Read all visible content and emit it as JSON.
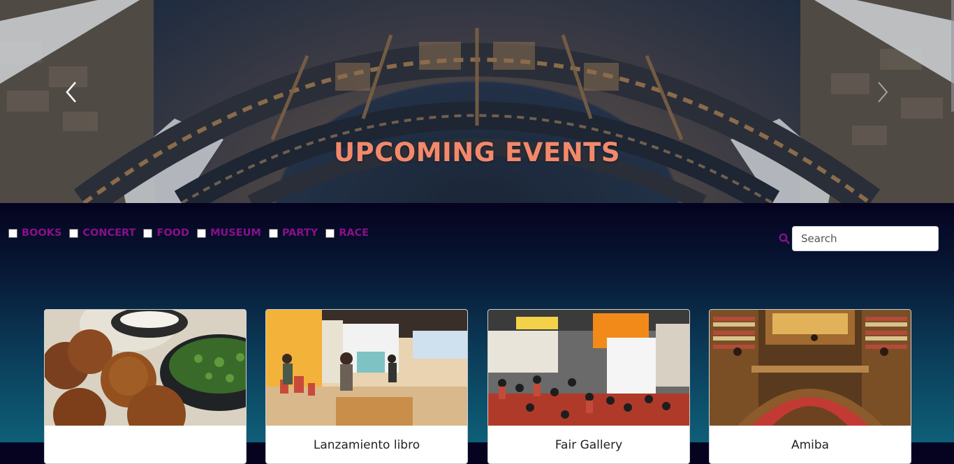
{
  "hero": {
    "title": "UPCOMING EVENTS",
    "title_color": "#f2896b"
  },
  "carousel": {
    "prev_icon": "chevron-left-icon",
    "next_icon": "chevron-right-icon"
  },
  "filters": [
    {
      "label": "BOOKS",
      "checked": false
    },
    {
      "label": "CONCERT",
      "checked": false
    },
    {
      "label": "FOOD",
      "checked": false
    },
    {
      "label": "MUSEUM",
      "checked": false
    },
    {
      "label": "PARTY",
      "checked": false
    },
    {
      "label": "RACE",
      "checked": false
    }
  ],
  "filter_color": "#8a0f8a",
  "search": {
    "placeholder": "Search",
    "value": "",
    "icon": "search-icon"
  },
  "cards": [
    {
      "title": ""
    },
    {
      "title": "Lanzamiento libro"
    },
    {
      "title": "Fair Gallery"
    },
    {
      "title": "Amiba"
    }
  ]
}
